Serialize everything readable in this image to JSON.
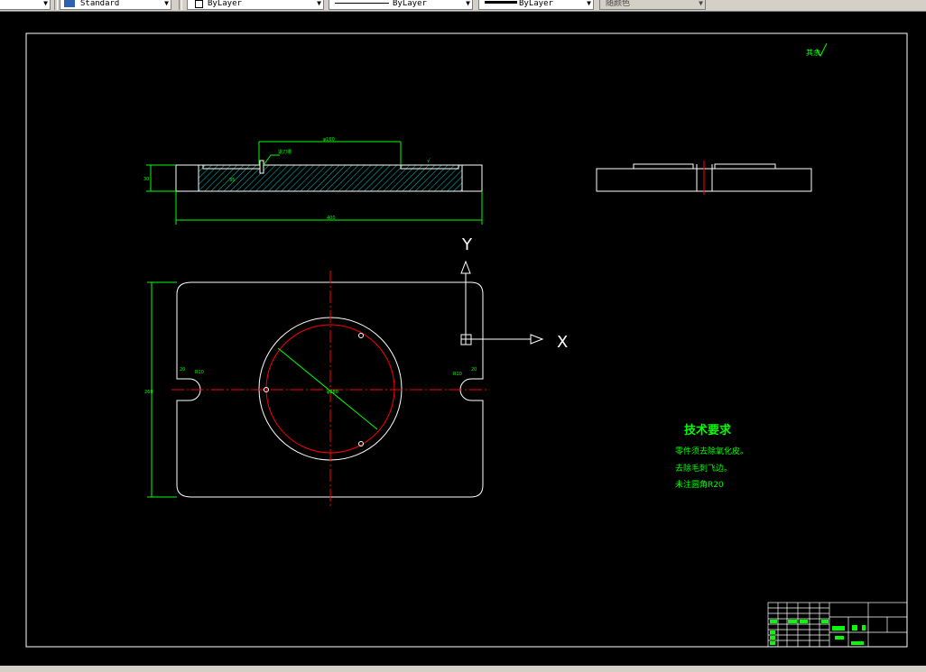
{
  "toolbar": {
    "text_style": "Standard",
    "layer": "ByLayer",
    "linetype": "ByLayer",
    "lineweight": "ByLayer",
    "plot_style": "随颜色"
  },
  "drawing": {
    "axis_y": "Y",
    "axis_x": "X",
    "roughness_note": "其余",
    "tech_title": "技术要求",
    "tech_lines": [
      "零件须去除氧化皮。",
      "去除毛刺飞边。",
      "未注圆角R20"
    ],
    "dim_top_width": "φ160",
    "dim_total_width": "400",
    "dim_height": "30",
    "dim_left_height": "260",
    "dim_circle_dia": "φ280",
    "dim_slot_left": "20",
    "dim_slot_right": "20",
    "dim_slot_radius": "R10",
    "dim_slot_radius_r": "R10",
    "dim_hatch_label": "35",
    "dim_note_label": "退刀槽",
    "dim_rough_label": "√",
    "colors": {
      "outline": "#ffffff",
      "center": "#ff0000",
      "dim": "#00ff00",
      "hatch": "#00d0d0"
    }
  }
}
